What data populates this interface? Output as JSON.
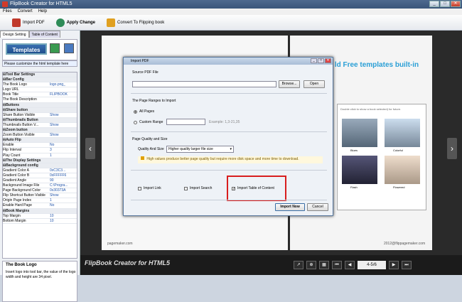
{
  "window": {
    "title": "FlipBook Creator for HTML5"
  },
  "menu": [
    "Files",
    "Convert",
    "Help"
  ],
  "toolbar": {
    "import": "Import PDF",
    "apply": "Apply Change",
    "convert": "Convert To Flipping book"
  },
  "left": {
    "tabs": [
      "Design Setting",
      "Table of Content"
    ],
    "templates_label": "Templates",
    "customize_text": "Please customize the html template here",
    "props": [
      {
        "k": "⊟Tool Bar Settings",
        "v": "",
        "s": true
      },
      {
        "k": " ⊟Bar Config",
        "v": "",
        "s": true
      },
      {
        "k": "   The Book Logo",
        "v": "logo.png_"
      },
      {
        "k": "   Logo URL",
        "v": ""
      },
      {
        "k": "   Book Title",
        "v": "FLIPBOOK"
      },
      {
        "k": "   The Book Description",
        "v": ""
      },
      {
        "k": " ⊟Buttons",
        "v": "",
        "s": true
      },
      {
        "k": "  ⊟Share button",
        "v": "",
        "s": true
      },
      {
        "k": "    Share Button Visible",
        "v": "Show"
      },
      {
        "k": "  ⊟Thumbnails Button",
        "v": "",
        "s": true
      },
      {
        "k": "    Thumbnails Button V...",
        "v": "Show"
      },
      {
        "k": "  ⊟Zoom button",
        "v": "",
        "s": true
      },
      {
        "k": "    Zoom Button Visible",
        "v": "Show"
      },
      {
        "k": " ⊟Auto Flip",
        "v": "",
        "s": true
      },
      {
        "k": "   Enable",
        "v": "No"
      },
      {
        "k": "   Flip Interval",
        "v": "3"
      },
      {
        "k": "   Play Count",
        "v": "1"
      },
      {
        "k": "⊟The Display Settings",
        "v": "",
        "s": true
      },
      {
        "k": " ⊟Background config",
        "v": "",
        "s": true
      },
      {
        "k": "   Gradient Color A",
        "v": "0xC3C3..."
      },
      {
        "k": "   Gradient Color B",
        "v": "0xFFFFF6"
      },
      {
        "k": "   Gradient Angle",
        "v": "90"
      },
      {
        "k": "   Background Image File",
        "v": "C:\\Progra..."
      },
      {
        "k": "  Page Background Color",
        "v": "0x30373A"
      },
      {
        "k": "  Flip Shortcut Button Visible",
        "v": "Show"
      },
      {
        "k": "  Origin Page Index",
        "v": "1"
      },
      {
        "k": "  Enable Hard Page",
        "v": "No"
      },
      {
        "k": " ⊟Book Margins",
        "v": "",
        "s": true
      },
      {
        "k": "   Top Margin",
        "v": "10"
      },
      {
        "k": "   Bottom Margin",
        "v": "10"
      }
    ],
    "desc_title": "The Book Logo",
    "desc_text": "Insert logo into tool bar, the value of the logo width and height are 34 pixel."
  },
  "book": {
    "banner": "ld Free templates built-in",
    "left_footer": "pagemaker.com",
    "right_footer": "2012@flippagemaker.com",
    "right_caption_1": "Blues",
    "right_caption_2": "Colorful",
    "right_caption_3": "Flash",
    "right_caption_4": "Flowered",
    "inner_note": "Double click to show a book selected) for future."
  },
  "dialog": {
    "title": "Import PDF",
    "source_label": "Source PDF File",
    "browse": "Browse...",
    "open": "Open",
    "range_label": "The Page Ranges to Import",
    "all_pages": "All Pages",
    "custom_range": "Custom Range",
    "example": "Example: 1,3-21,35",
    "quality_label": "Page Quality and Size",
    "quality_size": "Quality And Size",
    "quality_value": "Higher quality larger file size",
    "warn": "High values produce better page quality but require more disk space and more time to download.",
    "import_link": "Import Link",
    "import_search": "Import Search",
    "import_toc": "Import Table of Content",
    "import_now": "Import Now",
    "cancel": "Cancel"
  },
  "bottom": {
    "logo": "FlipBook Creator for HTML5",
    "page": "4-5/6"
  }
}
